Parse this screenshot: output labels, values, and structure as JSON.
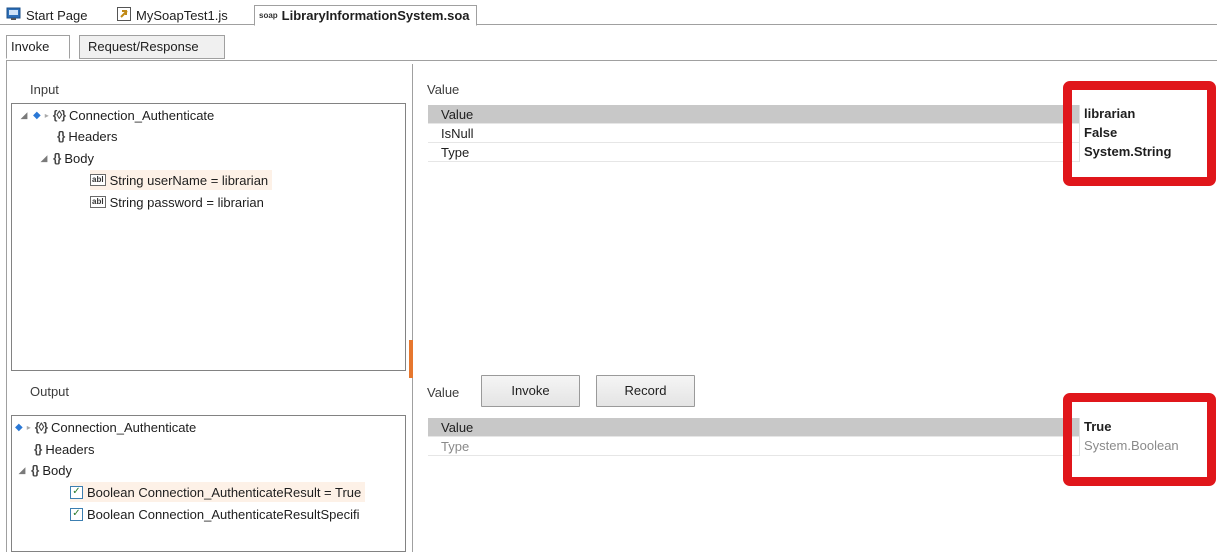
{
  "doc_tabs": [
    {
      "label": "Start Page"
    },
    {
      "label": "MySoapTest1.js"
    },
    {
      "label": "LibraryInformationSystem.soa",
      "icon_text": "soap"
    }
  ],
  "sub_tabs": [
    "Invoke",
    "Request/Response"
  ],
  "input": {
    "label": "Input",
    "tree": {
      "root": "Connection_Authenticate",
      "headers": "Headers",
      "body": "Body",
      "params": [
        "String userName = librarian",
        "String password = librarian"
      ],
      "param_icon": "abl"
    }
  },
  "input_value": {
    "label": "Value",
    "rows": [
      {
        "name": "Value",
        "value": "librarian"
      },
      {
        "name": "IsNull",
        "value": "False"
      },
      {
        "name": "Type",
        "value": "System.String"
      }
    ]
  },
  "output": {
    "label": "Output",
    "tree": {
      "root": "Connection_Authenticate",
      "headers": "Headers",
      "body": "Body",
      "results": [
        "Boolean Connection_AuthenticateResult = True",
        "Boolean Connection_AuthenticateResultSpecifi"
      ]
    }
  },
  "output_value": {
    "label": "Value",
    "invoke_button": "Invoke",
    "record_button": "Record",
    "rows": [
      {
        "name": "Value",
        "value": "True"
      },
      {
        "name": "Type",
        "value": "System.Boolean"
      }
    ]
  },
  "colors": {
    "highlight": "#e0161b",
    "splitter": "#e6772e",
    "selected_row": "#c8c8c8"
  }
}
